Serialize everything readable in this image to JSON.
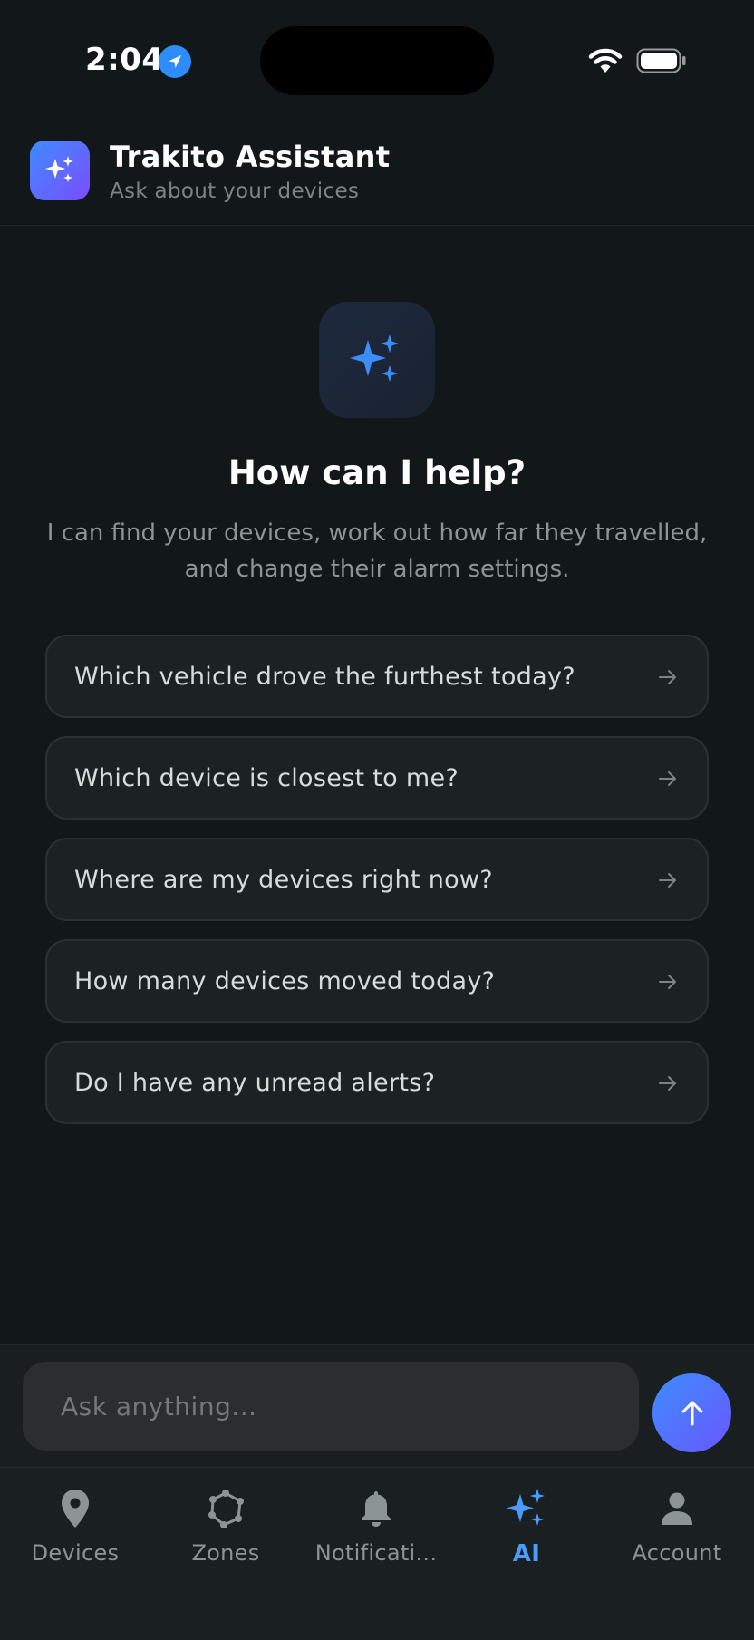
{
  "status_bar": {
    "time": "2:04"
  },
  "header": {
    "title": "Trakito Assistant",
    "subtitle": "Ask about your devices"
  },
  "hero": {
    "title": "How can I help?",
    "description": "I can find your devices, work out how far they travelled, and change their alarm settings."
  },
  "suggestions": [
    {
      "label": "Which vehicle drove the furthest today?"
    },
    {
      "label": "Which device is closest to me?"
    },
    {
      "label": "Where are my devices right now?"
    },
    {
      "label": "How many devices moved today?"
    },
    {
      "label": "Do I have any unread alerts?"
    }
  ],
  "input": {
    "placeholder": "Ask anything..."
  },
  "tabs": [
    {
      "label": "Devices",
      "icon": "map-pin-icon"
    },
    {
      "label": "Zones",
      "icon": "zone-polygon-icon"
    },
    {
      "label": "Notificati...",
      "icon": "bell-icon"
    },
    {
      "label": "AI",
      "icon": "sparkles-icon",
      "active": true
    },
    {
      "label": "Account",
      "icon": "person-icon"
    }
  ],
  "colors": {
    "background": "#121819",
    "accent": "#4a9cff",
    "accent_gradient_end": "#6a57ff"
  }
}
